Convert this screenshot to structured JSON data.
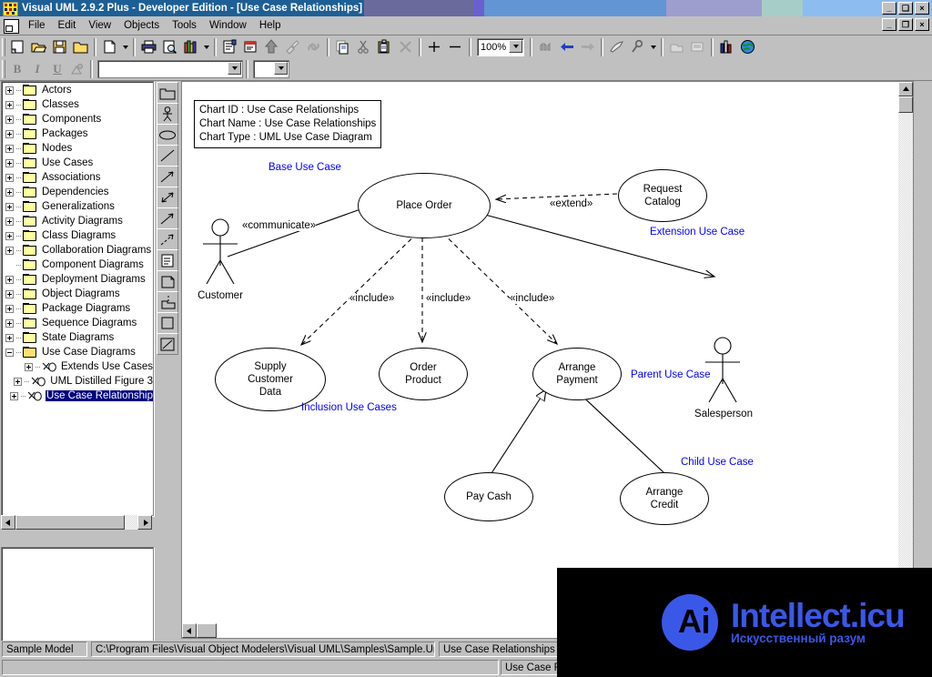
{
  "window": {
    "title": "Visual UML 2.9.2 Plus - Developer Edition - [Use Case Relationships]",
    "minimize_label": "_",
    "maximize_label": "❑",
    "close_label": "×",
    "mdi_restore_label": "❐",
    "mdi_minimize_label": "_",
    "mdi_close_label": "×"
  },
  "menubar": {
    "items": [
      {
        "label": "File"
      },
      {
        "label": "Edit"
      },
      {
        "label": "View"
      },
      {
        "label": "Objects"
      },
      {
        "label": "Tools"
      },
      {
        "label": "Window"
      },
      {
        "label": "Help"
      }
    ]
  },
  "toolbar": {
    "zoom_value": "100%",
    "font_name_value": "",
    "font_size_value": "",
    "buttons": [
      {
        "name": "new-model-icon",
        "glyph": "▭"
      },
      {
        "name": "open-model-icon",
        "glyph": "📂"
      },
      {
        "name": "save-model-icon",
        "glyph": "💾"
      },
      {
        "name": "save-as-icon",
        "glyph": "🗁"
      },
      {
        "name": "new-chart-icon",
        "glyph": "🗋"
      },
      {
        "name": "print-icon",
        "glyph": "🖨"
      },
      {
        "name": "print-preview-icon",
        "glyph": "🔎"
      },
      {
        "name": "reports-icon",
        "glyph": "📚"
      },
      {
        "name": "properties-icon",
        "glyph": "📝"
      },
      {
        "name": "notes-icon",
        "glyph": "🗒"
      },
      {
        "name": "promote-icon",
        "glyph": "⬆"
      },
      {
        "name": "paint-icon",
        "glyph": "🖌"
      },
      {
        "name": "link-icon",
        "glyph": "🔗"
      },
      {
        "name": "copy-icon",
        "glyph": "⧉"
      },
      {
        "name": "cut-icon",
        "glyph": "✂"
      },
      {
        "name": "paste-icon",
        "glyph": "📋"
      },
      {
        "name": "delete-icon",
        "glyph": "✕"
      },
      {
        "name": "add-icon",
        "glyph": "＋"
      },
      {
        "name": "remove-icon",
        "glyph": "—"
      },
      {
        "name": "reverse-engineer-icon",
        "glyph": "⚙"
      },
      {
        "name": "back-icon",
        "glyph": "⬅"
      },
      {
        "name": "forward-icon",
        "glyph": "➡"
      },
      {
        "name": "generate-code-icon",
        "glyph": "➤"
      },
      {
        "name": "options-icon",
        "glyph": "🔧"
      },
      {
        "name": "browser-icon",
        "glyph": "🗂"
      },
      {
        "name": "dictionary-icon",
        "glyph": "📑"
      },
      {
        "name": "metrics-icon",
        "glyph": "📊"
      },
      {
        "name": "web-icon",
        "glyph": "🌍"
      }
    ],
    "format_buttons": [
      {
        "name": "bold-button",
        "label": "B"
      },
      {
        "name": "italic-button",
        "label": "I"
      },
      {
        "name": "underline-button",
        "label": "U"
      },
      {
        "name": "font-color-button",
        "label": "🎨"
      }
    ]
  },
  "tree": {
    "items": [
      {
        "label": "Actors",
        "level": 0,
        "expandable": true,
        "expanded": false,
        "icon": "folder"
      },
      {
        "label": "Classes",
        "level": 0,
        "expandable": true,
        "expanded": false,
        "icon": "folder"
      },
      {
        "label": "Components",
        "level": 0,
        "expandable": true,
        "expanded": false,
        "icon": "folder"
      },
      {
        "label": "Packages",
        "level": 0,
        "expandable": true,
        "expanded": false,
        "icon": "folder"
      },
      {
        "label": "Nodes",
        "level": 0,
        "expandable": true,
        "expanded": false,
        "icon": "folder"
      },
      {
        "label": "Use Cases",
        "level": 0,
        "expandable": true,
        "expanded": false,
        "icon": "folder"
      },
      {
        "label": "Associations",
        "level": 0,
        "expandable": true,
        "expanded": false,
        "icon": "folder"
      },
      {
        "label": "Dependencies",
        "level": 0,
        "expandable": true,
        "expanded": false,
        "icon": "folder"
      },
      {
        "label": "Generalizations",
        "level": 0,
        "expandable": true,
        "expanded": false,
        "icon": "folder"
      },
      {
        "label": "Activity Diagrams",
        "level": 0,
        "expandable": true,
        "expanded": false,
        "icon": "folder"
      },
      {
        "label": "Class Diagrams",
        "level": 0,
        "expandable": true,
        "expanded": false,
        "icon": "folder"
      },
      {
        "label": "Collaboration Diagrams",
        "level": 0,
        "expandable": true,
        "expanded": false,
        "icon": "folder"
      },
      {
        "label": "Component Diagrams",
        "level": 0,
        "expandable": false,
        "expanded": false,
        "icon": "folder"
      },
      {
        "label": "Deployment Diagrams",
        "level": 0,
        "expandable": true,
        "expanded": false,
        "icon": "folder"
      },
      {
        "label": "Object Diagrams",
        "level": 0,
        "expandable": true,
        "expanded": false,
        "icon": "folder"
      },
      {
        "label": "Package Diagrams",
        "level": 0,
        "expandable": true,
        "expanded": false,
        "icon": "folder"
      },
      {
        "label": "Sequence Diagrams",
        "level": 0,
        "expandable": true,
        "expanded": false,
        "icon": "folder"
      },
      {
        "label": "State Diagrams",
        "level": 0,
        "expandable": true,
        "expanded": false,
        "icon": "folder"
      },
      {
        "label": "Use Case Diagrams",
        "level": 0,
        "expandable": true,
        "expanded": true,
        "icon": "folder-open"
      },
      {
        "label": "Extends Use Cases",
        "level": 1,
        "expandable": true,
        "expanded": false,
        "icon": "usecase"
      },
      {
        "label": "UML Distilled Figure 3",
        "level": 1,
        "expandable": true,
        "expanded": false,
        "icon": "usecase"
      },
      {
        "label": "Use Case Relationship",
        "level": 1,
        "expandable": true,
        "expanded": false,
        "icon": "usecase",
        "selected": true
      }
    ]
  },
  "palette": {
    "tools": [
      {
        "name": "package-tool",
        "title": "Package"
      },
      {
        "name": "actor-tool",
        "title": "Actor"
      },
      {
        "name": "usecase-tool",
        "title": "Use Case"
      },
      {
        "name": "line-tool",
        "title": "Line"
      },
      {
        "name": "association-tool",
        "title": "Association"
      },
      {
        "name": "bidirectional-tool",
        "title": "Bidirectional Association"
      },
      {
        "name": "generalization-tool",
        "title": "Generalization"
      },
      {
        "name": "dependency-tool",
        "title": "Dependency"
      },
      {
        "name": "note-tool",
        "title": "Note"
      },
      {
        "name": "document-tool",
        "title": "Document"
      },
      {
        "name": "anchor-tool",
        "title": "Anchor"
      },
      {
        "name": "rectangle-tool",
        "title": "Rectangle"
      },
      {
        "name": "freeline-tool",
        "title": "Free Line"
      }
    ]
  },
  "diagram": {
    "info": {
      "chart_id_label": "Chart ID : Use Case Relationships",
      "chart_name_label": "Chart Name : Use Case Relationships",
      "chart_type_label": "Chart Type : UML Use Case Diagram"
    },
    "use_cases": [
      {
        "id": "place-order",
        "label": "Place Order"
      },
      {
        "id": "request-catalog",
        "label": "Request\nCatalog",
        "line1": "Request",
        "line2": "Catalog"
      },
      {
        "id": "supply-customer-data",
        "line1": "Supply",
        "line2": "Customer",
        "line3": "Data"
      },
      {
        "id": "order-product",
        "line1": "Order",
        "line2": "Product"
      },
      {
        "id": "arrange-payment",
        "line1": "Arrange",
        "line2": "Payment"
      },
      {
        "id": "pay-cash",
        "label": "Pay Cash"
      },
      {
        "id": "arrange-credit",
        "line1": "Arrange",
        "line2": "Credit"
      }
    ],
    "actors": [
      {
        "id": "customer",
        "label": "Customer"
      },
      {
        "id": "salesperson",
        "label": "Salesperson"
      }
    ],
    "stereotypes": {
      "communicate": "«communicate»",
      "extend": "«extend»",
      "include1": "«include»",
      "include2": "«include»",
      "include3": "«include»"
    },
    "annotations": {
      "base": "Base Use Case",
      "extension": "Extension Use Case",
      "inclusion": "Inclusion Use Cases",
      "parent": "Parent Use Case",
      "child": "Child Use Case"
    },
    "annotation_color": "#0000ff"
  },
  "statusbar": {
    "model_name": "Sample Model",
    "file_path": "C:\\Program Files\\Visual Object Modelers\\Visual UML\\Samples\\Sample.Uml",
    "chart_name": "Use Case Relationships",
    "message": "",
    "secondary": "Use Case Rel"
  },
  "watermark": {
    "logo_letter": "A",
    "title": "Intellect.icu",
    "subtitle": "Искусственный разум",
    "color": "#3a58e8"
  }
}
